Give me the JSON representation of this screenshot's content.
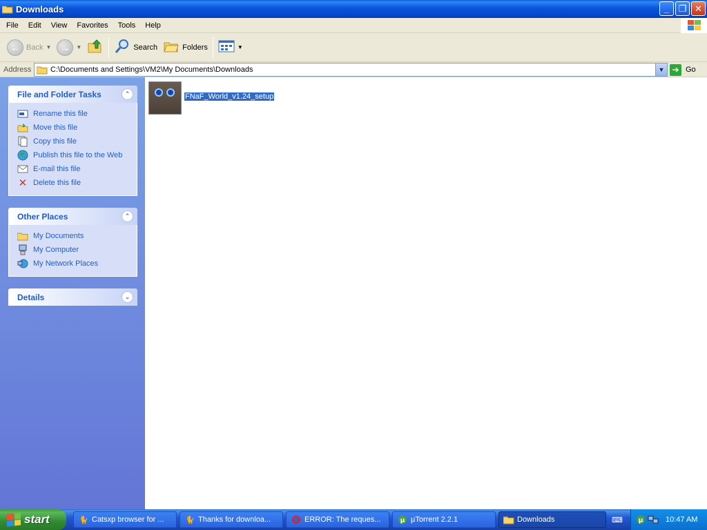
{
  "window": {
    "title": "Downloads"
  },
  "menu": [
    "File",
    "Edit",
    "View",
    "Favorites",
    "Tools",
    "Help"
  ],
  "toolbar": {
    "back": "Back",
    "search": "Search",
    "folders": "Folders"
  },
  "address": {
    "label": "Address",
    "path": "C:\\Documents and Settings\\VM2\\My Documents\\Downloads",
    "go": "Go"
  },
  "tasks_panel": {
    "title": "File and Folder Tasks",
    "items": [
      {
        "label": "Rename this file",
        "icon": "rename-icon"
      },
      {
        "label": "Move this file",
        "icon": "move-icon"
      },
      {
        "label": "Copy this file",
        "icon": "copy-icon"
      },
      {
        "label": "Publish this file to the Web",
        "icon": "globe-icon"
      },
      {
        "label": "E-mail this file",
        "icon": "email-icon"
      },
      {
        "label": "Delete this file",
        "icon": "delete-icon"
      }
    ]
  },
  "places_panel": {
    "title": "Other Places",
    "items": [
      {
        "label": "My Documents",
        "icon": "folder-icon"
      },
      {
        "label": "My Computer",
        "icon": "computer-icon"
      },
      {
        "label": "My Network Places",
        "icon": "network-icon"
      }
    ]
  },
  "details_panel": {
    "title": "Details"
  },
  "file": {
    "name": "FNaF_World_v1.24_setup"
  },
  "taskbar": {
    "start": "start",
    "tasks": [
      {
        "label": "Catsxp browser for ..."
      },
      {
        "label": "Thanks for downloa..."
      },
      {
        "label": "ERROR: The reques..."
      },
      {
        "label": "µTorrent 2.2.1"
      },
      {
        "label": "Downloads"
      }
    ],
    "clock": "10:47 AM"
  },
  "colors": {
    "title_bar": "#0855dd",
    "selection": "#316ac5",
    "link": "#215dc6",
    "pane": "#6375d6"
  }
}
